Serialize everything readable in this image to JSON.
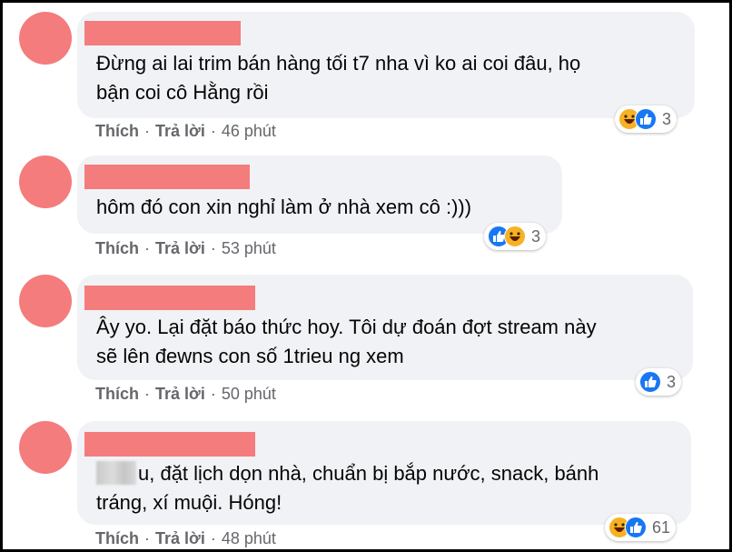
{
  "colors": {
    "avatar_placeholder": "#f47c7c",
    "bubble_bg": "#f0f2f5",
    "meta_text": "#65676b",
    "like_blue": "#1877f2",
    "haha_yellow": "#f7b125"
  },
  "comments": [
    {
      "text": "Đừng ai lai trim bán hàng tối t7 nha vì ko ai coi đâu, họ\nbận coi cô Hằng rồi",
      "like_label": "Thích",
      "reply_label": "Trả lời",
      "time": "46 phút",
      "reactions": [
        "haha-icon",
        "like-icon"
      ],
      "reaction_count": "3"
    },
    {
      "text": "hôm đó con xin nghỉ làm ở nhà xem cô :)))",
      "like_label": "Thích",
      "reply_label": "Trả lời",
      "time": "53 phút",
      "reactions": [
        "like-icon",
        "haha-icon"
      ],
      "reaction_count": "3"
    },
    {
      "text": "Ây yo. Lại đặt báo thức hoy. Tôi dự đoán đợt stream này\nsẽ lên đewns con số 1trieu ng xem",
      "like_label": "Thích",
      "reply_label": "Trả lời",
      "time": "50 phút",
      "reactions": [
        "like-icon"
      ],
      "reaction_count": "3"
    },
    {
      "text_visible": "u, đặt lịch dọn nhà, chuẩn bị bắp nước, snack, bánh",
      "text_line2": "tráng, xí muội. Hóng!",
      "like_label": "Thích",
      "reply_label": "Trả lời",
      "time": "48 phút",
      "reactions": [
        "haha-icon",
        "like-icon"
      ],
      "reaction_count": "61"
    }
  ]
}
